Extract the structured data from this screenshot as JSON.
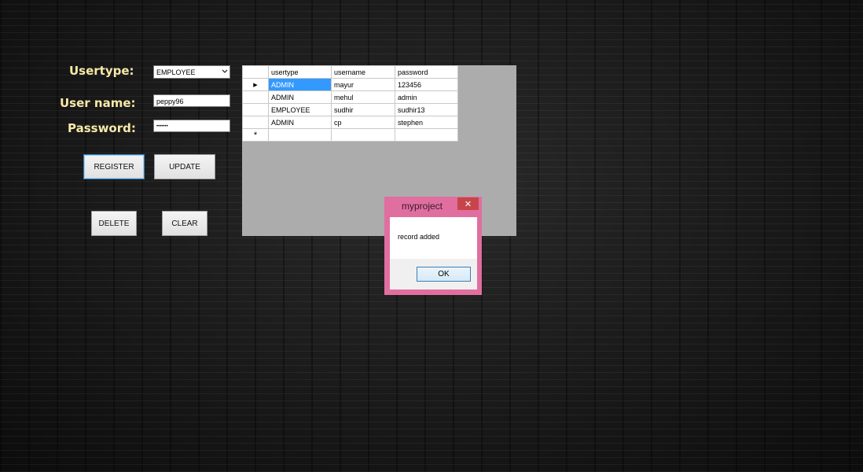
{
  "form": {
    "usertype_label": "Usertype:",
    "username_label": "User name:",
    "password_label": "Password:",
    "usertype_value": "EMPLOYEE",
    "username_value": "peppy96",
    "password_value": "•••••••"
  },
  "buttons": {
    "register": "REGISTER",
    "update": "UPDATE",
    "delete": "DELETE",
    "clear": "CLEAR"
  },
  "grid": {
    "columns": [
      "usertype",
      "username",
      "password"
    ],
    "rows": [
      [
        "ADMIN",
        "mayur",
        "123456"
      ],
      [
        "ADMIN",
        "mehul",
        "admin"
      ],
      [
        "EMPLOYEE",
        "sudhir",
        "sudhir13"
      ],
      [
        "ADMIN",
        "cp",
        "stephen"
      ]
    ],
    "current_row_marker": "▶",
    "new_row_marker": "*"
  },
  "dialog": {
    "title": "myproject",
    "close": "✕",
    "message": "record added",
    "ok": "OK"
  },
  "icons": {
    "dropdown": "chevron-down-icon",
    "close": "close-icon"
  },
  "colors": {
    "label": "#f7e9a8",
    "dialog_frame": "#e06fa0",
    "selection": "#3399ff",
    "close_button": "#c7454a"
  }
}
